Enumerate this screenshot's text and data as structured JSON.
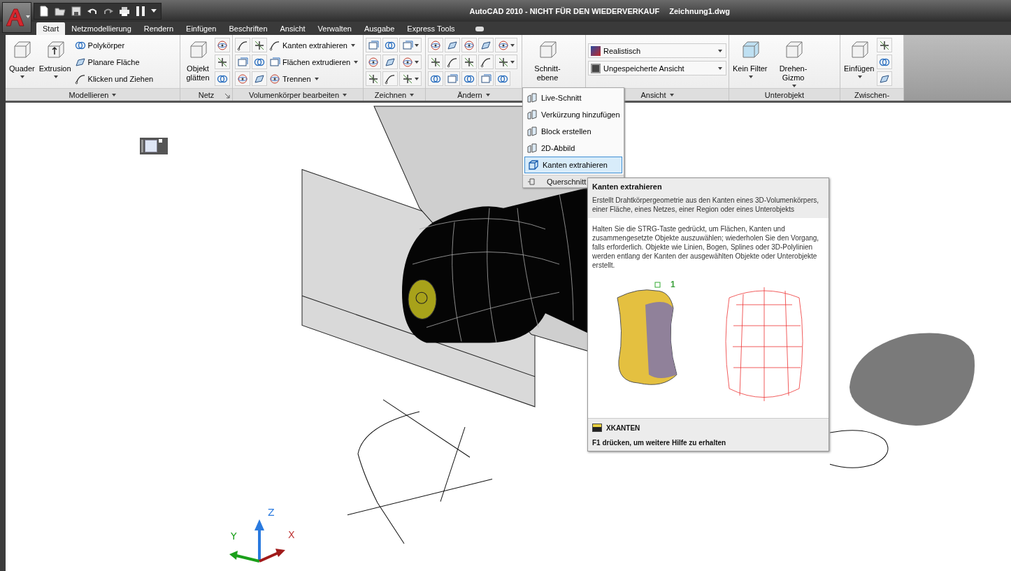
{
  "title_bar": {
    "product": "AutoCAD 2010 - NICHT FÜR DEN WIEDERVERKAUF",
    "file": "Zeichnung1.dwg"
  },
  "tabs": [
    {
      "label": "Start",
      "selected": true
    },
    {
      "label": "Netzmodellierung",
      "selected": false
    },
    {
      "label": "Rendern",
      "selected": false
    },
    {
      "label": "Einfügen",
      "selected": false
    },
    {
      "label": "Beschriften",
      "selected": false
    },
    {
      "label": "Ansicht",
      "selected": false
    },
    {
      "label": "Verwalten",
      "selected": false
    },
    {
      "label": "Ausgabe",
      "selected": false
    },
    {
      "label": "Express Tools",
      "selected": false
    }
  ],
  "panels": [
    {
      "title": "Modellieren",
      "menu": true,
      "launcher": false,
      "items": [
        {
          "kind": "large",
          "label": "Quader",
          "dropdown": true
        },
        {
          "kind": "large",
          "label": "Extrusion",
          "dropdown": true
        },
        {
          "kind": "list",
          "entries": [
            {
              "label": "Polykörper",
              "dropdown": false
            },
            {
              "label": "Planare Fläche",
              "dropdown": false
            },
            {
              "label": "Klicken und Ziehen",
              "dropdown": false
            }
          ]
        }
      ]
    },
    {
      "title": "Netz",
      "menu": false,
      "launcher": true,
      "items": [
        {
          "kind": "large",
          "label": "Objekt glätten",
          "dropdown": false
        },
        {
          "kind": "icons",
          "arrows": [
            false,
            false,
            false
          ]
        }
      ]
    },
    {
      "title": "Volumenkörper bearbeiten",
      "menu": true,
      "launcher": false,
      "items": [
        {
          "kind": "icons",
          "arrows": [
            false,
            false,
            false
          ]
        },
        {
          "kind": "icons",
          "arrows": [
            false,
            false,
            false
          ]
        },
        {
          "kind": "list",
          "entries": [
            {
              "label": "Kanten extrahieren",
              "dropdown": true
            },
            {
              "label": "Flächen extrudieren",
              "dropdown": true
            },
            {
              "label": "Trennen",
              "dropdown": true
            }
          ]
        }
      ]
    },
    {
      "title": "Zeichnen",
      "menu": true,
      "launcher": false,
      "items": [
        {
          "kind": "icons",
          "arrows": [
            false,
            false,
            false
          ]
        },
        {
          "kind": "icons",
          "arrows": [
            false,
            false,
            false
          ]
        },
        {
          "kind": "icons",
          "arrows": [
            true,
            true,
            true
          ]
        }
      ]
    },
    {
      "title": "Ändern",
      "menu": true,
      "launcher": false,
      "items": [
        {
          "kind": "icons",
          "arrows": [
            false,
            false,
            false
          ]
        },
        {
          "kind": "icons",
          "arrows": [
            false,
            false,
            false
          ]
        },
        {
          "kind": "icons",
          "arrows": [
            false,
            false,
            false
          ]
        },
        {
          "kind": "icons",
          "arrows": [
            false,
            false,
            false
          ]
        },
        {
          "kind": "icons",
          "arrows": [
            true,
            true,
            false
          ]
        }
      ]
    },
    {
      "items": [
        {
          "kind": "large",
          "label": "Schnitt-ebene",
          "dropdown": false
        }
      ]
    },
    {
      "title": "Ansicht",
      "menu": true,
      "launcher": false,
      "items": [
        {
          "kind": "selects",
          "entries": [
            {
              "value": "Realistisch"
            },
            {
              "value": "Ungespeicherte Ansicht"
            }
          ]
        }
      ]
    },
    {
      "title": "Unterobjekt",
      "menu": false,
      "launcher": false,
      "items": [
        {
          "kind": "large",
          "label": "Kein Filter",
          "dropdown": true
        },
        {
          "kind": "large",
          "label": "Drehen-Gizmo",
          "dropdown": true
        }
      ]
    },
    {
      "title": "Zwischen-",
      "menu": false,
      "launcher": false,
      "items": [
        {
          "kind": "large",
          "label": "Einfügen",
          "dropdown": true
        },
        {
          "kind": "icons",
          "arrows": [
            false,
            false,
            false
          ]
        }
      ]
    }
  ],
  "section_menu": {
    "items": [
      {
        "label": "Live-Schnitt",
        "selected": false
      },
      {
        "label": "Verkürzung hinzufügen",
        "selected": false
      },
      {
        "label": "Block erstellen",
        "selected": false
      },
      {
        "label": "2D-Abbild",
        "selected": false
      },
      {
        "label": "Kanten extrahieren",
        "selected": true
      }
    ],
    "footer": "Querschnitt"
  },
  "tooltip": {
    "title": "Kanten extrahieren",
    "description": "Erstellt Drahtkörpergeometrie aus den Kanten eines 3D-Volumenkörpers, einer Fläche, eines Netzes, einer Region oder eines Unterobjekts",
    "details": "Halten Sie die STRG-Taste gedrückt, um Flächen, Kanten und zusammengesetzte Objekte auszuwählen; wiederholen Sie den Vorgang, falls erforderlich. Objekte wie Linien, Bogen, Splines oder 3D-Polylinien werden entlang der Kanten der ausgewählten Objekte oder Unterobjekte erstellt.",
    "image_label": "1",
    "command": "XKANTEN",
    "help": "F1 drücken, um weitere Hilfe zu erhalten"
  },
  "ucs": {
    "z": "Z",
    "y": "Y",
    "x": "X"
  }
}
